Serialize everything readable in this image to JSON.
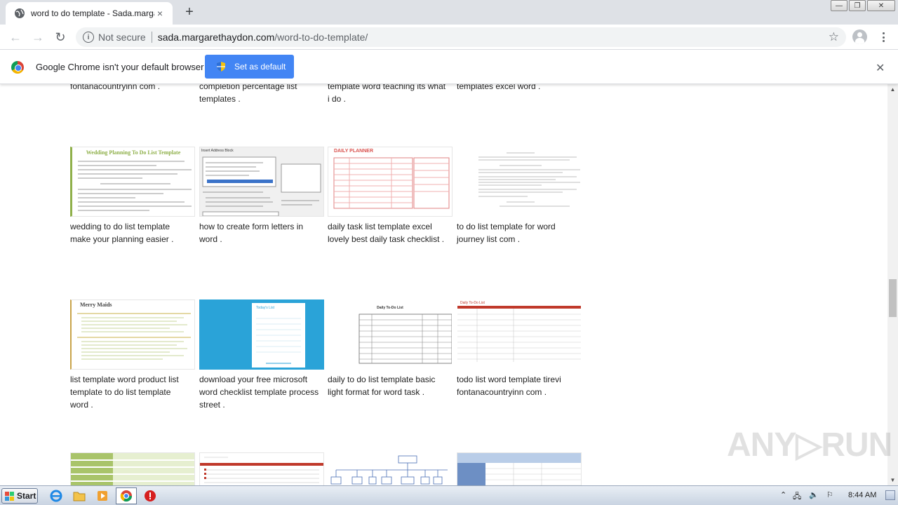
{
  "tab": {
    "title": "word to do template - Sada.margare",
    "close": "×"
  },
  "newtab": "+",
  "window_controls": {
    "minimize": "—",
    "maximize": "❐",
    "close": "✕"
  },
  "toolbar": {
    "back": "←",
    "forward": "→",
    "reload": "↻",
    "security_text": "Not secure",
    "url_host": "sada.margarethaydon.com",
    "url_path": "/word-to-do-template/",
    "bookmark": "☆"
  },
  "infobar": {
    "message": "Google Chrome isn't your default browser",
    "button": "Set as default",
    "close": "✕"
  },
  "captions": {
    "r0c0": [
      "fontanacountryinn com ."
    ],
    "r0c1": [
      "completion percentage list",
      "templates ."
    ],
    "r0c2": [
      "template word teaching its what",
      "i do ."
    ],
    "r0c3": [
      "templates excel word ."
    ],
    "r1c0": [
      "wedding to do list template",
      "make your planning easier ."
    ],
    "r1c1": [
      "how to create form letters in",
      "word ."
    ],
    "r1c2": [
      "daily task list template excel",
      "lovely best daily task checklist ."
    ],
    "r1c3": [
      "to do list template for word",
      "journey list com ."
    ],
    "r2c0": [
      "list template word product list",
      "template to do list template",
      "word ."
    ],
    "r2c1": [
      "download your free microsoft",
      "word checklist template process",
      "street ."
    ],
    "r2c2": [
      "daily to do list template basic",
      "light format for word task ."
    ],
    "r2c3": [
      "todo list word template tirevi",
      "fontanacountryinn com ."
    ]
  },
  "thumb_text": {
    "wedding_title": "Wedding Planning To Do List Template",
    "dialog_title": "Insert Address Block",
    "planner_title": "DAILY PLANNER",
    "maid_title": "Merry Maids",
    "checklist_title": "Today's List",
    "daily_title": "Daily To-Do List",
    "todo_red_title": "Daily To-Do List"
  },
  "watermark": "ANY▷RUN",
  "taskbar": {
    "start": "Start",
    "clock": "8:44 AM"
  },
  "colors": {
    "accent": "#4285f4",
    "tab_strip": "#dee1e6",
    "taskbar": "#d6dfea"
  }
}
